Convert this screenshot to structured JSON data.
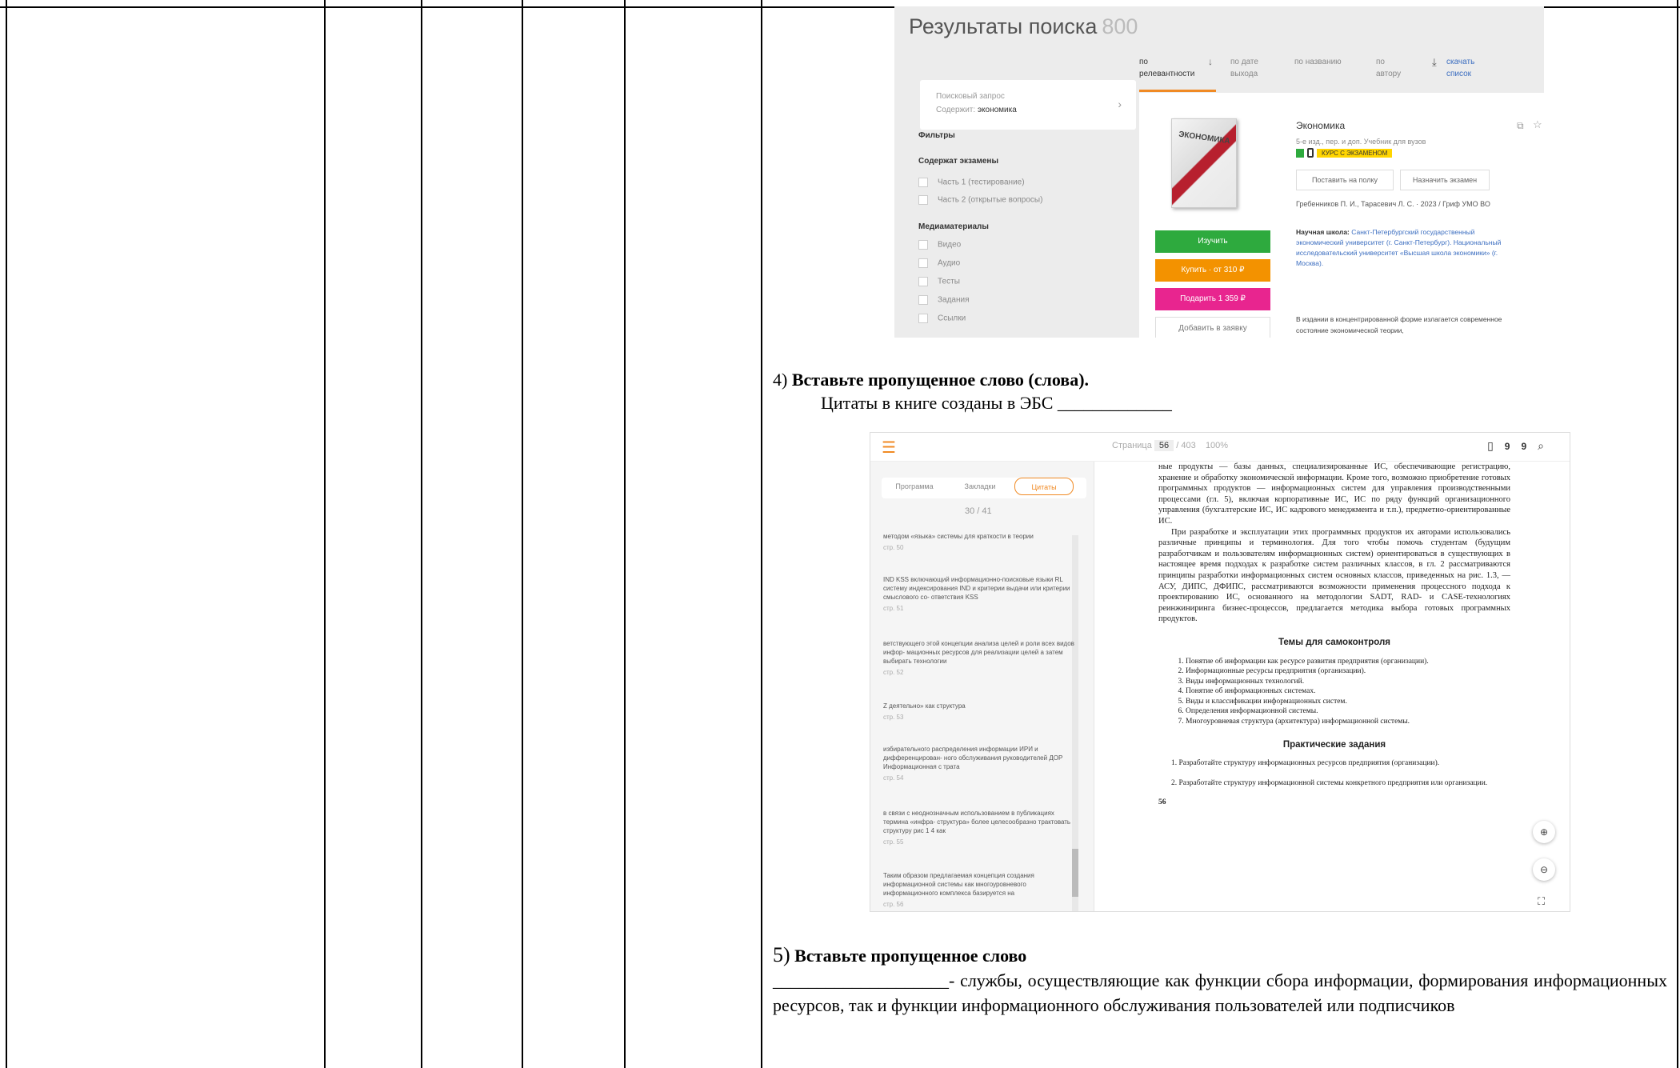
{
  "search_screenshot": {
    "title": "Результаты поиска",
    "count": "800",
    "sort_tabs": [
      "по релевантности",
      "по дате выхода",
      "по названию",
      "по автору",
      "скачать список"
    ],
    "query_label": "Поисковый запрос",
    "query_prefix": "Содержит:",
    "query_value": "экономика",
    "filters_title": "Фильтры",
    "exams_title": "Содержат экзамены",
    "exam_options": [
      "Часть 1 (тестирование)",
      "Часть 2 (открытые вопросы)"
    ],
    "media_title": "Медиаматериалы",
    "media_options": [
      "Видео",
      "Аудио",
      "Тесты",
      "Задания",
      "Ссылки"
    ],
    "cover_text": "ЭКОНОМИКА",
    "book_title": "Экономика",
    "edition": "5-е изд., пер. и доп. Учебник для вузов",
    "exam_badge": "КУРС С ЭКЗАМЕНОМ",
    "shelf_button": "Поставить на полку",
    "assign_button": "Назначить экзамен",
    "authors": "Гребенников П. И., Тарасевич Л. С. · 2023 / Гриф УМО ВО",
    "school_label": "Научная школа:",
    "school_text": "Санкт-Петербургский государственный экономический университет (г. Санкт-Петербург). Национальный исследовательский университет «Высшая школа экономики» (г. Москва).",
    "description": "В издании в концентрированной форме излагается современное состояние экономической теории,",
    "action_buttons": [
      "Изучить",
      "Купить · от 310 ₽",
      "Подарить 1 359 ₽",
      "Добавить в заявку"
    ],
    "colors": {
      "study": "#2eaa3e",
      "buy": "#f39200",
      "gift": "#e8258f",
      "accent": "#f08a24"
    }
  },
  "q4": {
    "number": "4)",
    "heading": "Вставьте пропущенное слово (слова).",
    "sentence": "Цитаты в книге созданы в ЭБС _____________"
  },
  "reader_screenshot": {
    "page_label": "Страница",
    "page": "56",
    "total": "/ 403",
    "zoom": "100%",
    "quote_icon": "99",
    "tabs": [
      "Программа",
      "Закладки",
      "Цитаты"
    ],
    "quote_count": "30 / 41",
    "citations": [
      {
        "text": "методом «языка» системы для краткости в теории",
        "page": "стр. 50"
      },
      {
        "text": "IND KSS включающий информационно-поисковые языки RL систему индексирования IND и критерии выдачи или критерии смыслового со- ответствия KSS",
        "page": "стр. 51"
      },
      {
        "text": "ветствующего этой концепции анализа целей и роли всех видов инфор- мационных ресурсов для реализации целей а затем выбирать технологии",
        "page": "стр. 52"
      },
      {
        "text": "Z деятельно» как структура",
        "page": "стр. 53"
      },
      {
        "text": "избирательного распределения информации ИРИ и дифференцирован- ного обслуживания руководителей ДОР Информационная с трата",
        "page": "стр. 54"
      },
      {
        "text": "в связи с неоднозначным использованием в публикациях термина «инфра- структура» более целесообразно трактовать структуру рис 1 4 как",
        "page": "стр. 55"
      },
      {
        "text": "Таким образом предлагаемая концепция создания информационной системы как многоуровневого информационного комплекса базируется на",
        "page": "стр. 56"
      }
    ],
    "page_text_1": "ные продукты — базы данных, специализированные ИС, обеспечивающие регистрацию, хранение и обработку экономической информации. Кроме того, возможно приобретение готовых программных продуктов — информационных систем для управления производственными процессами (гл. 5), включая корпоративные ИС, ИС по ряду функций организационного управления (бухгалтерские ИС, ИС кадрового менеджмента и т.п.), предметно-ориентированные ИС.",
    "page_text_2": "При разработке и эксплуатации этих программных продуктов их авторами использовались различные принципы и терминология. Для того чтобы помочь студентам (будущим разработчикам и пользователям информационных систем) ориентироваться в существующих в настоящее время подходах к разработке систем различных классов, в гл. 2 рассматриваются принципы разработки информационных систем основных классов, приведенных на рис. 1.3, — АСУ, ДИПС, ДФИПС, рассматриваются возможности применения процессного подхода к проектированию ИС, основанного на методологии SADT, RAD- и CASE-технологиях реинжиниринга бизнес-процессов, предлагается методика выбора готовых программных продуктов.",
    "self_control_title": "Темы для самоконтроля",
    "self_control_items": [
      "Понятие об информации как ресурсе развития предприятия (организации).",
      "Информационные ресурсы предприятия (организации).",
      "Виды информационных технологий.",
      "Понятие об информационных системах.",
      "Виды и классификации информационных систем.",
      "Определения информационной системы.",
      "Многоуровневая структура (архитектура) информационной системы."
    ],
    "practice_title": "Практические задания",
    "practice_items": [
      "1. Разработайте структуру информационных ресурсов предприятия (организации).",
      "2. Разработайте структуру информационной системы конкретного предприятия или организации."
    ],
    "page_number": "56"
  },
  "q5": {
    "number": "5)",
    "heading": "Вставьте пропущенное слово",
    "text": "____________________- службы, осуществляющие как функции сбора информации, формирования информационных ресурсов, так и функции информационного обслуживания пользователей или подписчиков"
  }
}
